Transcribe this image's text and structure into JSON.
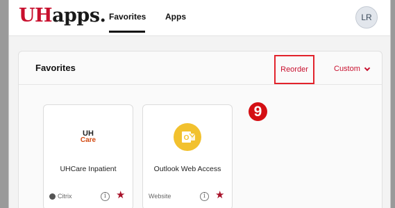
{
  "header": {
    "logo_uh": "UH",
    "logo_rest": "apps.",
    "tabs": [
      {
        "label": "Favorites",
        "active": true
      },
      {
        "label": "Apps",
        "active": false
      }
    ],
    "avatar_initials": "LR"
  },
  "favorites_panel": {
    "title": "Favorites",
    "reorder_label": "Reorder",
    "custom_label": "Custom",
    "custom_icon": "chevron-down-icon"
  },
  "tiles": [
    {
      "name": "UHCare Inpatient",
      "logo_line1": "UH",
      "logo_line2": "Care",
      "type": "Citrix",
      "type_icon": "citrix-icon",
      "info_glyph": "i",
      "star_glyph": "★"
    },
    {
      "name": "Outlook Web Access",
      "type": "Website",
      "info_glyph": "i",
      "star_glyph": "★"
    }
  ],
  "annotation": {
    "step_number": "9"
  },
  "colors": {
    "brand_red": "#c8102e",
    "highlight_box": "#e2232c",
    "star": "#a8122a",
    "outlook_yellow": "#f2c12e"
  }
}
